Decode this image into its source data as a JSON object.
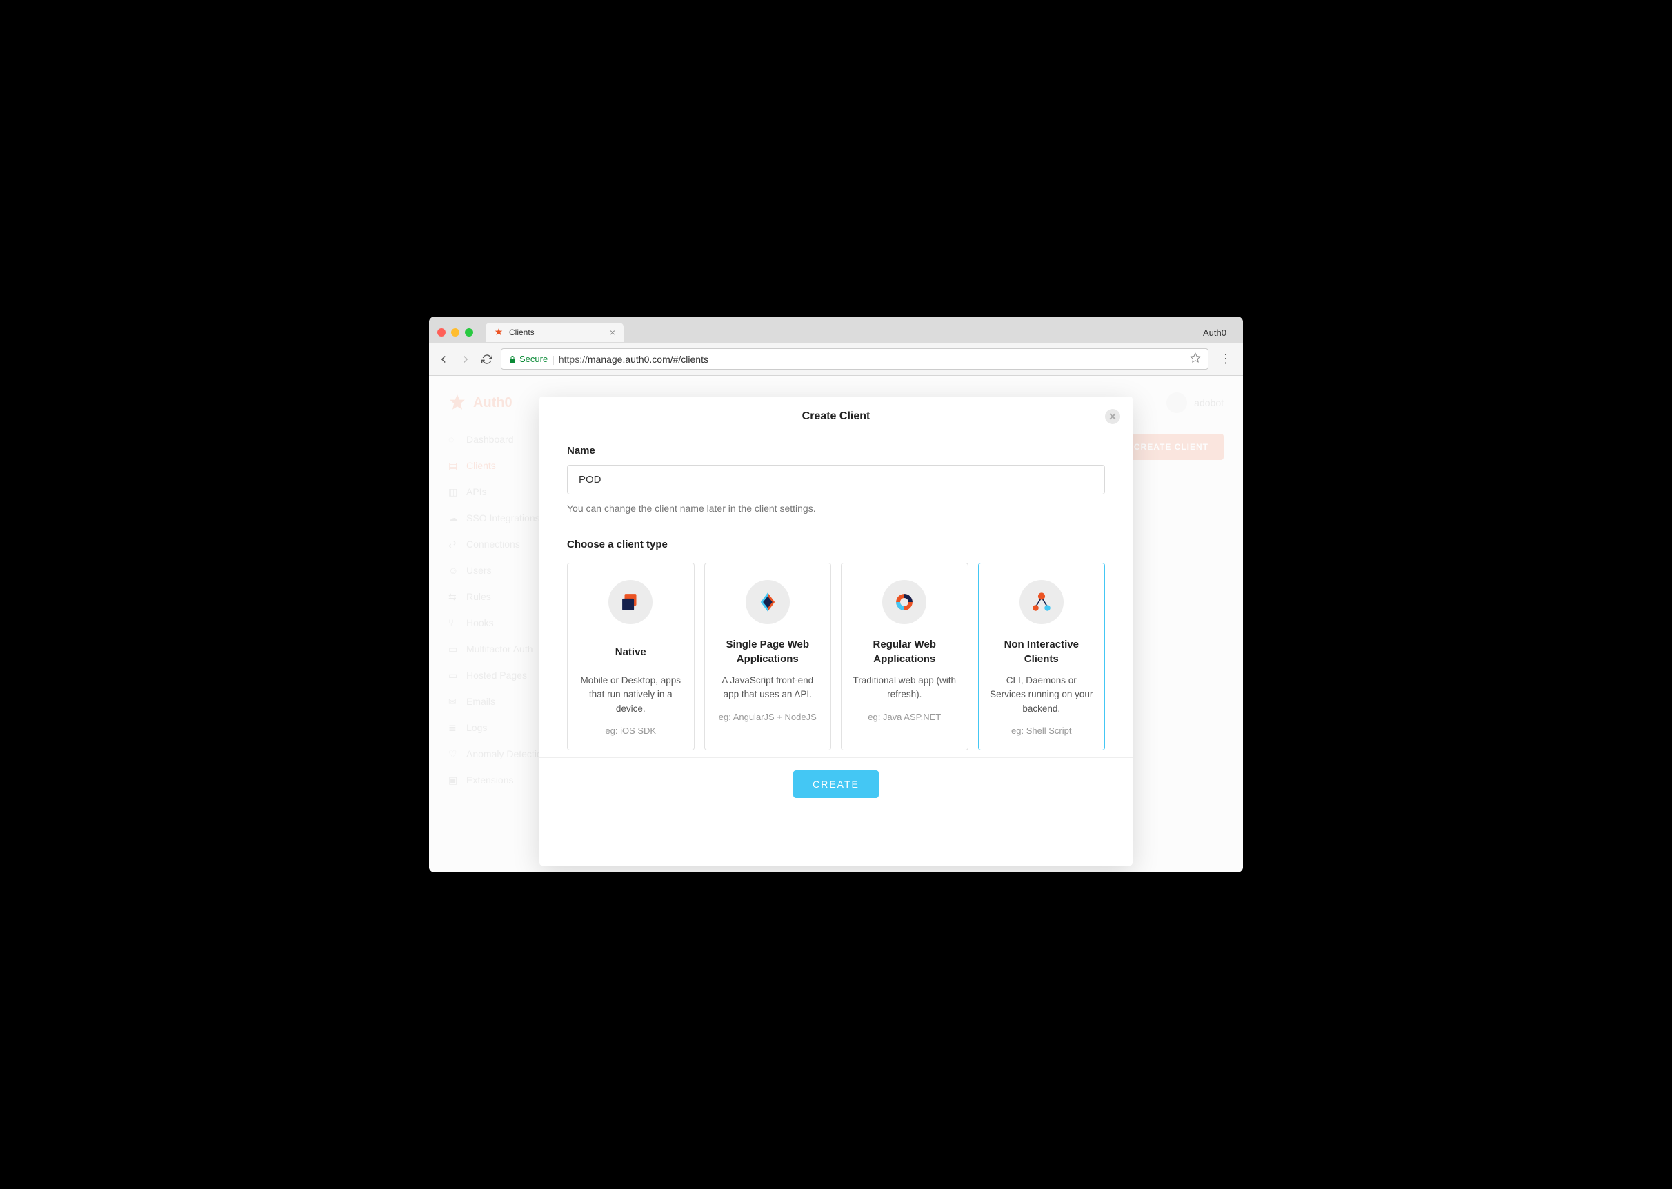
{
  "browser": {
    "tab_title": "Clients",
    "window_title": "Auth0",
    "secure_label": "Secure",
    "url_scheme": "https://",
    "url_rest": "manage.auth0.com/#/clients"
  },
  "bg": {
    "brand": "Auth0",
    "user": "adobot",
    "create_client_btn": "CREATE CLIENT",
    "sidebar": [
      {
        "label": "Dashboard"
      },
      {
        "label": "Clients"
      },
      {
        "label": "APIs"
      },
      {
        "label": "SSO Integrations"
      },
      {
        "label": "Connections"
      },
      {
        "label": "Users"
      },
      {
        "label": "Rules"
      },
      {
        "label": "Hooks"
      },
      {
        "label": "Multifactor Auth"
      },
      {
        "label": "Hosted Pages"
      },
      {
        "label": "Emails"
      },
      {
        "label": "Logs"
      },
      {
        "label": "Anomaly Detection"
      },
      {
        "label": "Extensions"
      }
    ]
  },
  "modal": {
    "title": "Create Client",
    "name_label": "Name",
    "name_value": "POD",
    "name_help": "You can change the client name later in the client settings.",
    "type_label": "Choose a client type",
    "create_label": "CREATE",
    "types": [
      {
        "title": "Native",
        "desc": "Mobile or Desktop, apps that run natively in a device.",
        "eg": "eg: iOS SDK",
        "selected": false
      },
      {
        "title": "Single Page Web Applications",
        "desc": "A JavaScript front-end app that uses an API.",
        "eg": "eg: AngularJS + NodeJS",
        "selected": false
      },
      {
        "title": "Regular Web Applications",
        "desc": "Traditional web app (with refresh).",
        "eg": "eg: Java ASP.NET",
        "selected": false
      },
      {
        "title": "Non Interactive Clients",
        "desc": "CLI, Daemons or Services running on your backend.",
        "eg": "eg: Shell Script",
        "selected": true
      }
    ]
  }
}
